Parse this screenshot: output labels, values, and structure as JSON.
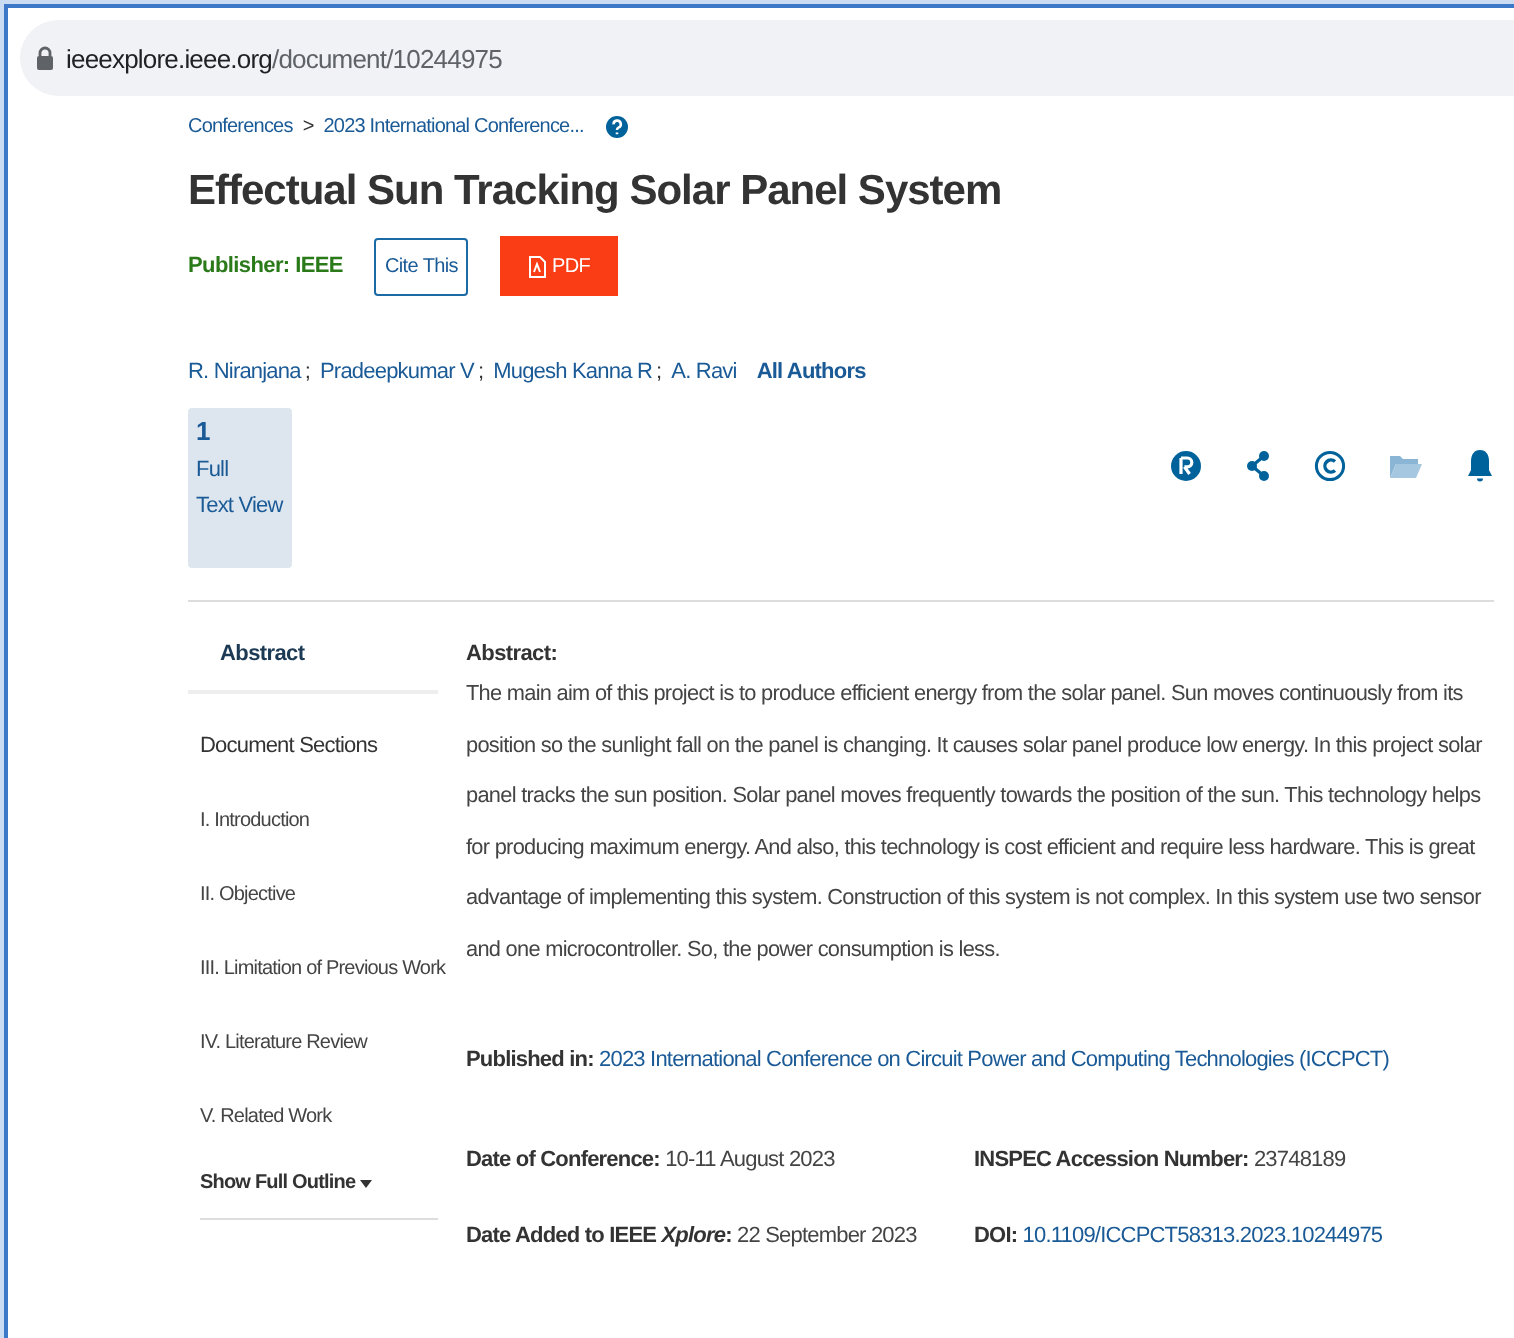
{
  "address_bar": {
    "url_host": "ieeexplore.ieee.org",
    "url_path": "/document/10244975"
  },
  "breadcrumbs": [
    {
      "label": "Conferences"
    },
    {
      "label": "2023 International Conference..."
    }
  ],
  "breadcrumb_separator": ">",
  "title": "Effectual Sun Tracking Solar Panel System",
  "publisher": {
    "label": "Publisher:",
    "value": "IEEE"
  },
  "buttons": [
    {
      "label": "Cite This",
      "kind": "outline"
    },
    {
      "label": "PDF",
      "kind": "pdf"
    }
  ],
  "authors": [
    {
      "name": "R. Niranjana"
    },
    {
      "name": "Pradeepkumar V"
    },
    {
      "name": "Mugesh Kanna R"
    },
    {
      "name": "A. Ravi"
    }
  ],
  "author_separator": ";",
  "all_authors": "All Authors",
  "metrics": {
    "count": "1",
    "line1": "Full",
    "line2": "Text View"
  },
  "sidebar": {
    "tab": {
      "label": "Abstract",
      "selected": true
    },
    "heading": "Document Sections",
    "items": [
      {
        "label": "I.  Introduction"
      },
      {
        "label": "II.  Objective"
      },
      {
        "label": "III.  Limitation of Previous Work"
      },
      {
        "label": "IV.  Literature Review"
      },
      {
        "label": "V.  Related Work"
      }
    ],
    "show_more": "Show Full Outline"
  },
  "abstract": {
    "heading": "Abstract:",
    "text": "The main aim of this project is to produce efficient energy from the solar panel. Sun moves continuously from its position so the sunlight fall on the panel is changing. It causes solar panel produce low energy. In this project solar panel tracks the sun position. Solar panel moves frequently towards the position of the sun. This technology helps for producing maximum energy. And also, this technology is cost efficient and require less hardware. This is great advantage of implementing this system. Construction of this system is not complex. In this system use two sensor and one microcontroller. So, the power consumption is less."
  },
  "published_in": {
    "label": "Published in:",
    "value": "2023 International Conference on Circuit Power and Computing Technologies (ICCPCT)"
  },
  "details": [
    {
      "label": "Date of Conference:",
      "value": "10-11 August 2023",
      "kind": "text"
    },
    {
      "label": "INSPEC Accession Number:",
      "value": "23748189",
      "kind": "text"
    },
    {
      "label": "Date Added to IEEE *Xplore*:",
      "value": "22 September 2023",
      "kind": "text"
    },
    {
      "label": "DOI:",
      "value": "10.1109/ICCPCT58313.2023.10244975",
      "kind": "link"
    }
  ]
}
